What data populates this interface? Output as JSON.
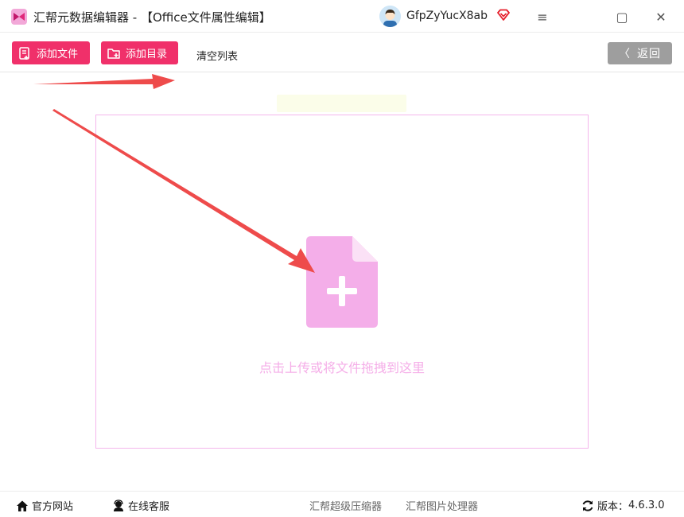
{
  "window": {
    "title": "汇帮元数据编辑器 - 【Office文件属性编辑】",
    "username": "GfpZyYucX8ab",
    "logo_icon": "app-logo-icon",
    "vip_icon": "vip-diamond-icon",
    "menu_glyph": "≡",
    "maximize_glyph": "▢",
    "close_glyph": "✕"
  },
  "toolbar": {
    "add_file_label": "添加文件",
    "add_dir_label": "添加目录",
    "clear_list_label": "清空列表",
    "back_label": "返回",
    "back_glyph": "〈"
  },
  "dropzone": {
    "hint": "点击上传或将文件拖拽到这里",
    "icon": "file-add-icon"
  },
  "statusbar": {
    "website_label": "官方网站",
    "support_label": "在线客服",
    "compressor_label": "汇帮超级压缩器",
    "image_tool_label": "汇帮图片处理器",
    "version_prefix": "版本：",
    "version": "4.6.3.0"
  },
  "colors": {
    "accent": "#f0306a",
    "dropzone_border": "#f4b6ec",
    "file_icon": "#f4aee9",
    "annotation_arrow": "#ee4b4b",
    "back_button": "#9e9e9e"
  }
}
